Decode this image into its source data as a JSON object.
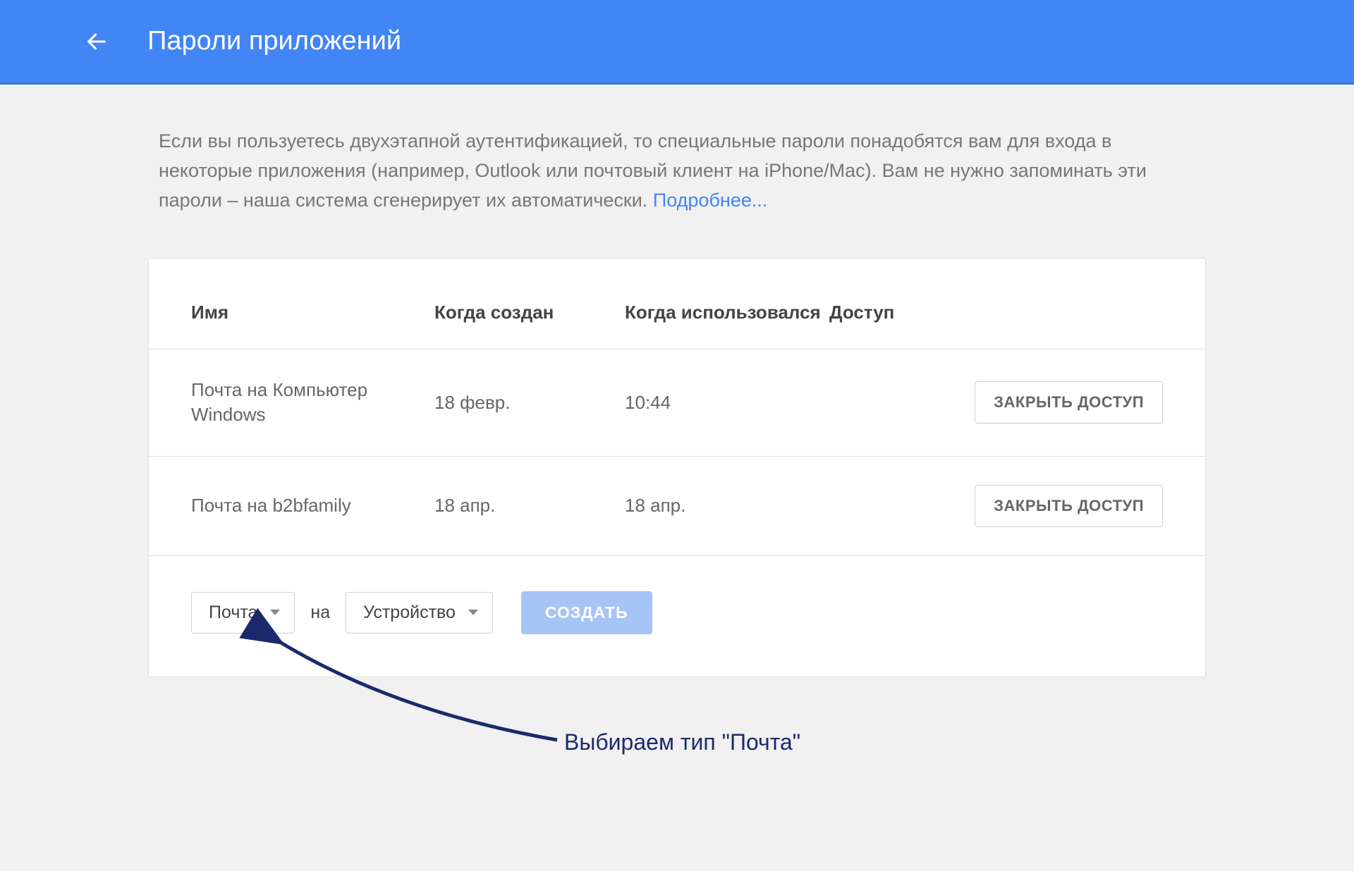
{
  "header": {
    "title": "Пароли приложений"
  },
  "description": {
    "text": "Если вы пользуетесь двухэтапной аутентификацией, то специальные пароли понадобятся вам для входа в некоторые приложения (например, Outlook или почтовый клиент на iPhone/Mac). Вам не нужно запоминать эти пароли – наша система сгенерирует их автоматически. ",
    "link": "Подробнее..."
  },
  "table": {
    "headers": {
      "name": "Имя",
      "created": "Когда создан",
      "used": "Когда использовался",
      "access": "Доступ"
    },
    "rows": [
      {
        "name": "Почта на Компьютер Windows",
        "created": "18 февр.",
        "used": "10:44",
        "revoke": "ЗАКРЫТЬ ДОСТУП"
      },
      {
        "name": "Почта на b2bfamily",
        "created": "18 апр.",
        "used": "18 апр.",
        "revoke": "ЗАКРЫТЬ ДОСТУП"
      }
    ]
  },
  "create": {
    "app_dropdown": "Почта",
    "sep": "на",
    "device_dropdown": "Устройство",
    "button": "СОЗДАТЬ"
  },
  "annotation": {
    "text": "Выбираем тип \"Почта\""
  }
}
